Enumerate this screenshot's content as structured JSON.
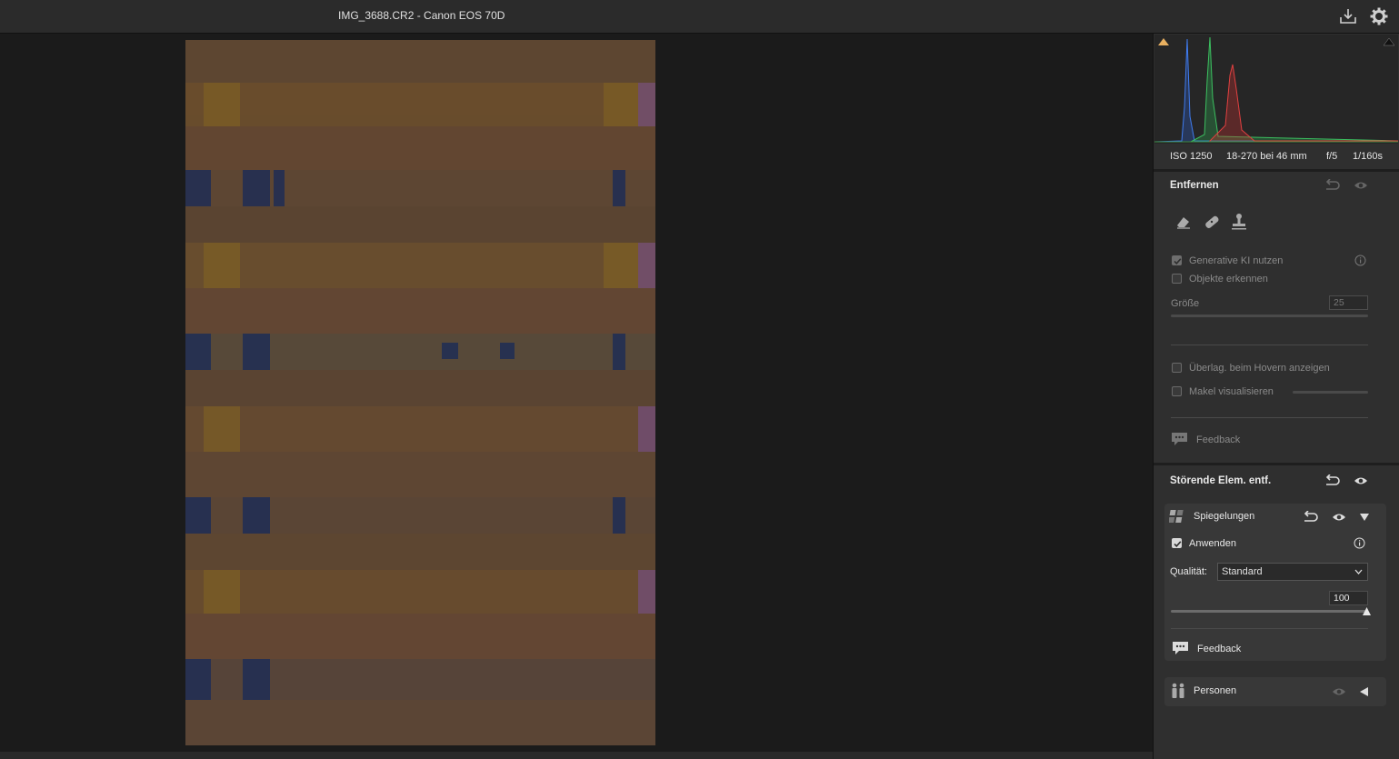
{
  "window": {
    "title": "IMG_3688.CR2 - Canon EOS 70D"
  },
  "toolbar": {
    "export_icon": "download-icon",
    "settings_icon": "gear-icon"
  },
  "exif": {
    "iso": "ISO 1250",
    "lens": "18-270 bei 46 mm",
    "aperture": "f/5",
    "shutter": "1/160s"
  },
  "entfernen": {
    "title": "Entfernen",
    "tools": [
      "eraser-icon",
      "bandage-icon",
      "stamp-icon"
    ],
    "generative_ai_label": "Generative KI nutzen",
    "detect_objects_label": "Objekte erkennen",
    "size_label": "Größe",
    "size_value": "25",
    "hover_overlay_label": "Überlag. beim Hovern anzeigen",
    "visualize_spots_label": "Makel visualisieren",
    "feedback_label": "Feedback"
  },
  "distracting": {
    "title": "Störende Elem. entf.",
    "reflections": {
      "label": "Spiegelungen",
      "apply_label": "Anwenden",
      "quality_label": "Qualität:",
      "quality_value": "Standard",
      "amount_value": "100",
      "feedback_label": "Feedback"
    },
    "persons": {
      "label": "Personen"
    }
  },
  "colors": {
    "bg": "#1c1c1c",
    "panel": "#2f2f2f",
    "photo_base": "#5c4530"
  }
}
